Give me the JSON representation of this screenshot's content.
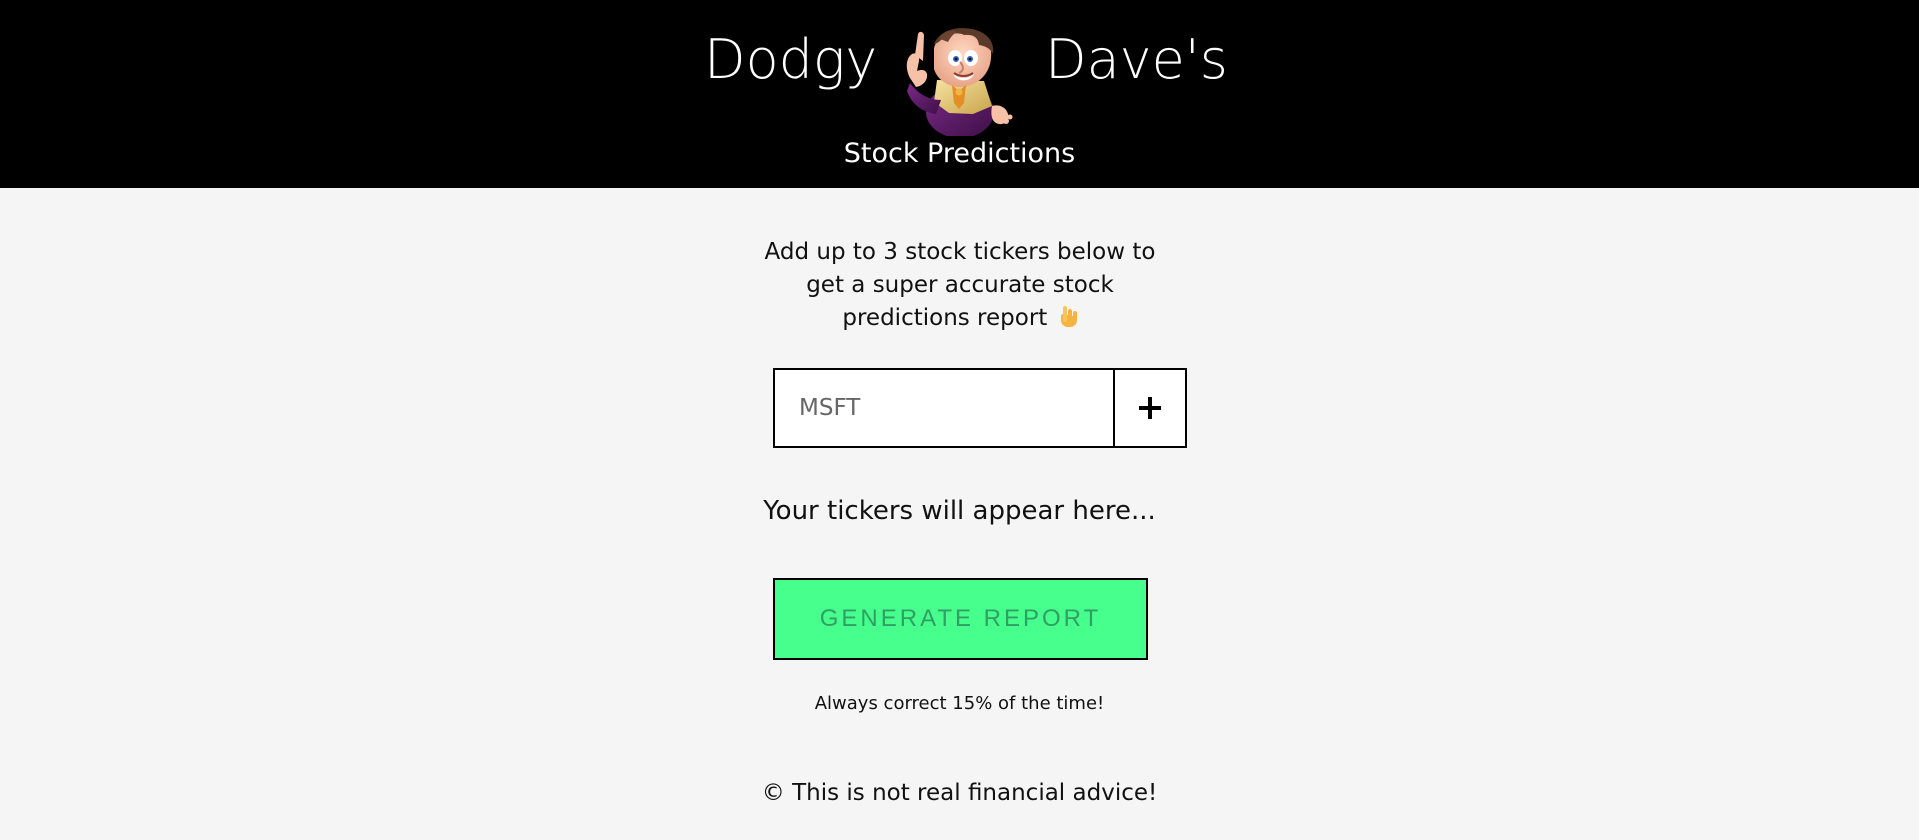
{
  "header": {
    "brand_left": "Dodgy",
    "brand_right": "Dave's",
    "subtitle": "Stock Predictions"
  },
  "intro": {
    "line1": "Add up to 3 stock tickers below to",
    "line2": "get a super accurate stock",
    "line3": "predictions report"
  },
  "ticker_input": {
    "placeholder": "MSFT",
    "value": ""
  },
  "tickers": {
    "empty_text": "Your tickers will appear here..."
  },
  "actions": {
    "generate_label": "Generate Report"
  },
  "tagline": "Always correct 15% of the time!",
  "footer": {
    "text": "© This is not real financial advice!"
  },
  "icons": {
    "mascot": "cartoon-mascot-icon",
    "pointing_hand": "backhand-index-pointing-down-icon",
    "add": "plus-icon"
  },
  "colors": {
    "header_bg": "#000000",
    "page_bg": "#f5f5f5",
    "generate_bg": "#46ff8d",
    "generate_text": "#2f9f63"
  }
}
